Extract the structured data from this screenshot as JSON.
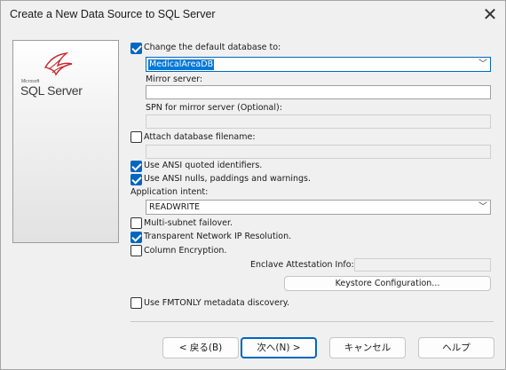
{
  "window": {
    "title": "Create a New Data Source to SQL Server"
  },
  "logo": {
    "microsoft": "Microsoft",
    "product": "SQL Server"
  },
  "options": {
    "change_db": {
      "label": "Change the default database to:",
      "checked": true
    },
    "database": {
      "value": "MedicalAreaDB"
    },
    "mirror_server": {
      "label": "Mirror server:",
      "value": ""
    },
    "spn": {
      "label": "SPN for mirror server (Optional):",
      "value": ""
    },
    "attach_db": {
      "label": "Attach database filename:",
      "checked": false,
      "value": ""
    },
    "ansi_quoted": {
      "label": "Use ANSI quoted identifiers.",
      "checked": true
    },
    "ansi_nulls": {
      "label": "Use ANSI nulls, paddings and warnings.",
      "checked": true
    },
    "app_intent": {
      "label": "Application intent:",
      "value": "READWRITE"
    },
    "multi_subnet": {
      "label": "Multi-subnet failover.",
      "checked": false
    },
    "tnir": {
      "label": "Transparent Network IP Resolution.",
      "checked": true
    },
    "column_enc": {
      "label": "Column Encryption.",
      "checked": false
    },
    "enclave": {
      "label": "Enclave Attestation Info:",
      "value": ""
    },
    "keystore": {
      "label": "Keystore Configuration..."
    },
    "fmtonly": {
      "label": "Use FMTONLY metadata discovery.",
      "checked": false
    }
  },
  "buttons": {
    "back": "< 戻る(B)",
    "next": "次へ(N) >",
    "cancel": "キャンセル",
    "help": "ヘルプ"
  },
  "colors": {
    "accent": "#0067c0",
    "selection": "#0078d7",
    "logo_red": "#c8252c"
  }
}
